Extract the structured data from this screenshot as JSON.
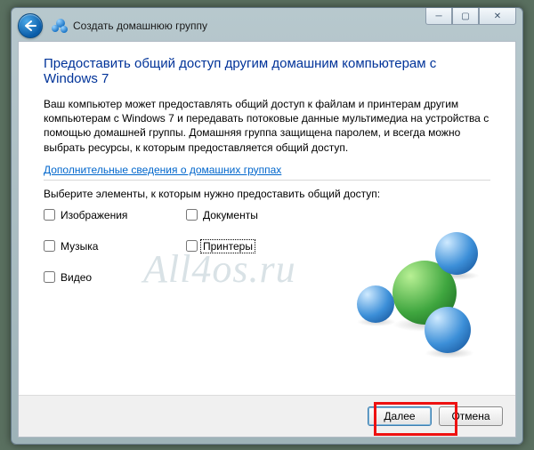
{
  "window": {
    "title": "Создать домашнюю группу",
    "heading": "Предоставить общий доступ другим домашним компьютерам с Windows 7",
    "description": "Ваш компьютер может предоставлять общий доступ к файлам и принтерам другим компьютерам с Windows 7 и передавать потоковые данные мультимедиа на устройства с помощью домашней группы. Домашняя группа защищена паролем, и всегда можно выбрать ресурсы, к которым предоставляется общий доступ.",
    "help_link": "Дополнительные сведения о домашних группах",
    "prompt": "Выберите элементы, к которым нужно предоставить общий доступ:"
  },
  "share_items": {
    "pictures": {
      "label": "Изображения",
      "checked": false
    },
    "documents": {
      "label": "Документы",
      "checked": false
    },
    "music": {
      "label": "Музыка",
      "checked": false
    },
    "printers": {
      "label": "Принтеры",
      "checked": false
    },
    "videos": {
      "label": "Видео",
      "checked": false
    }
  },
  "buttons": {
    "next": "Далее",
    "cancel": "Отмена"
  },
  "watermark": "All4os.ru"
}
